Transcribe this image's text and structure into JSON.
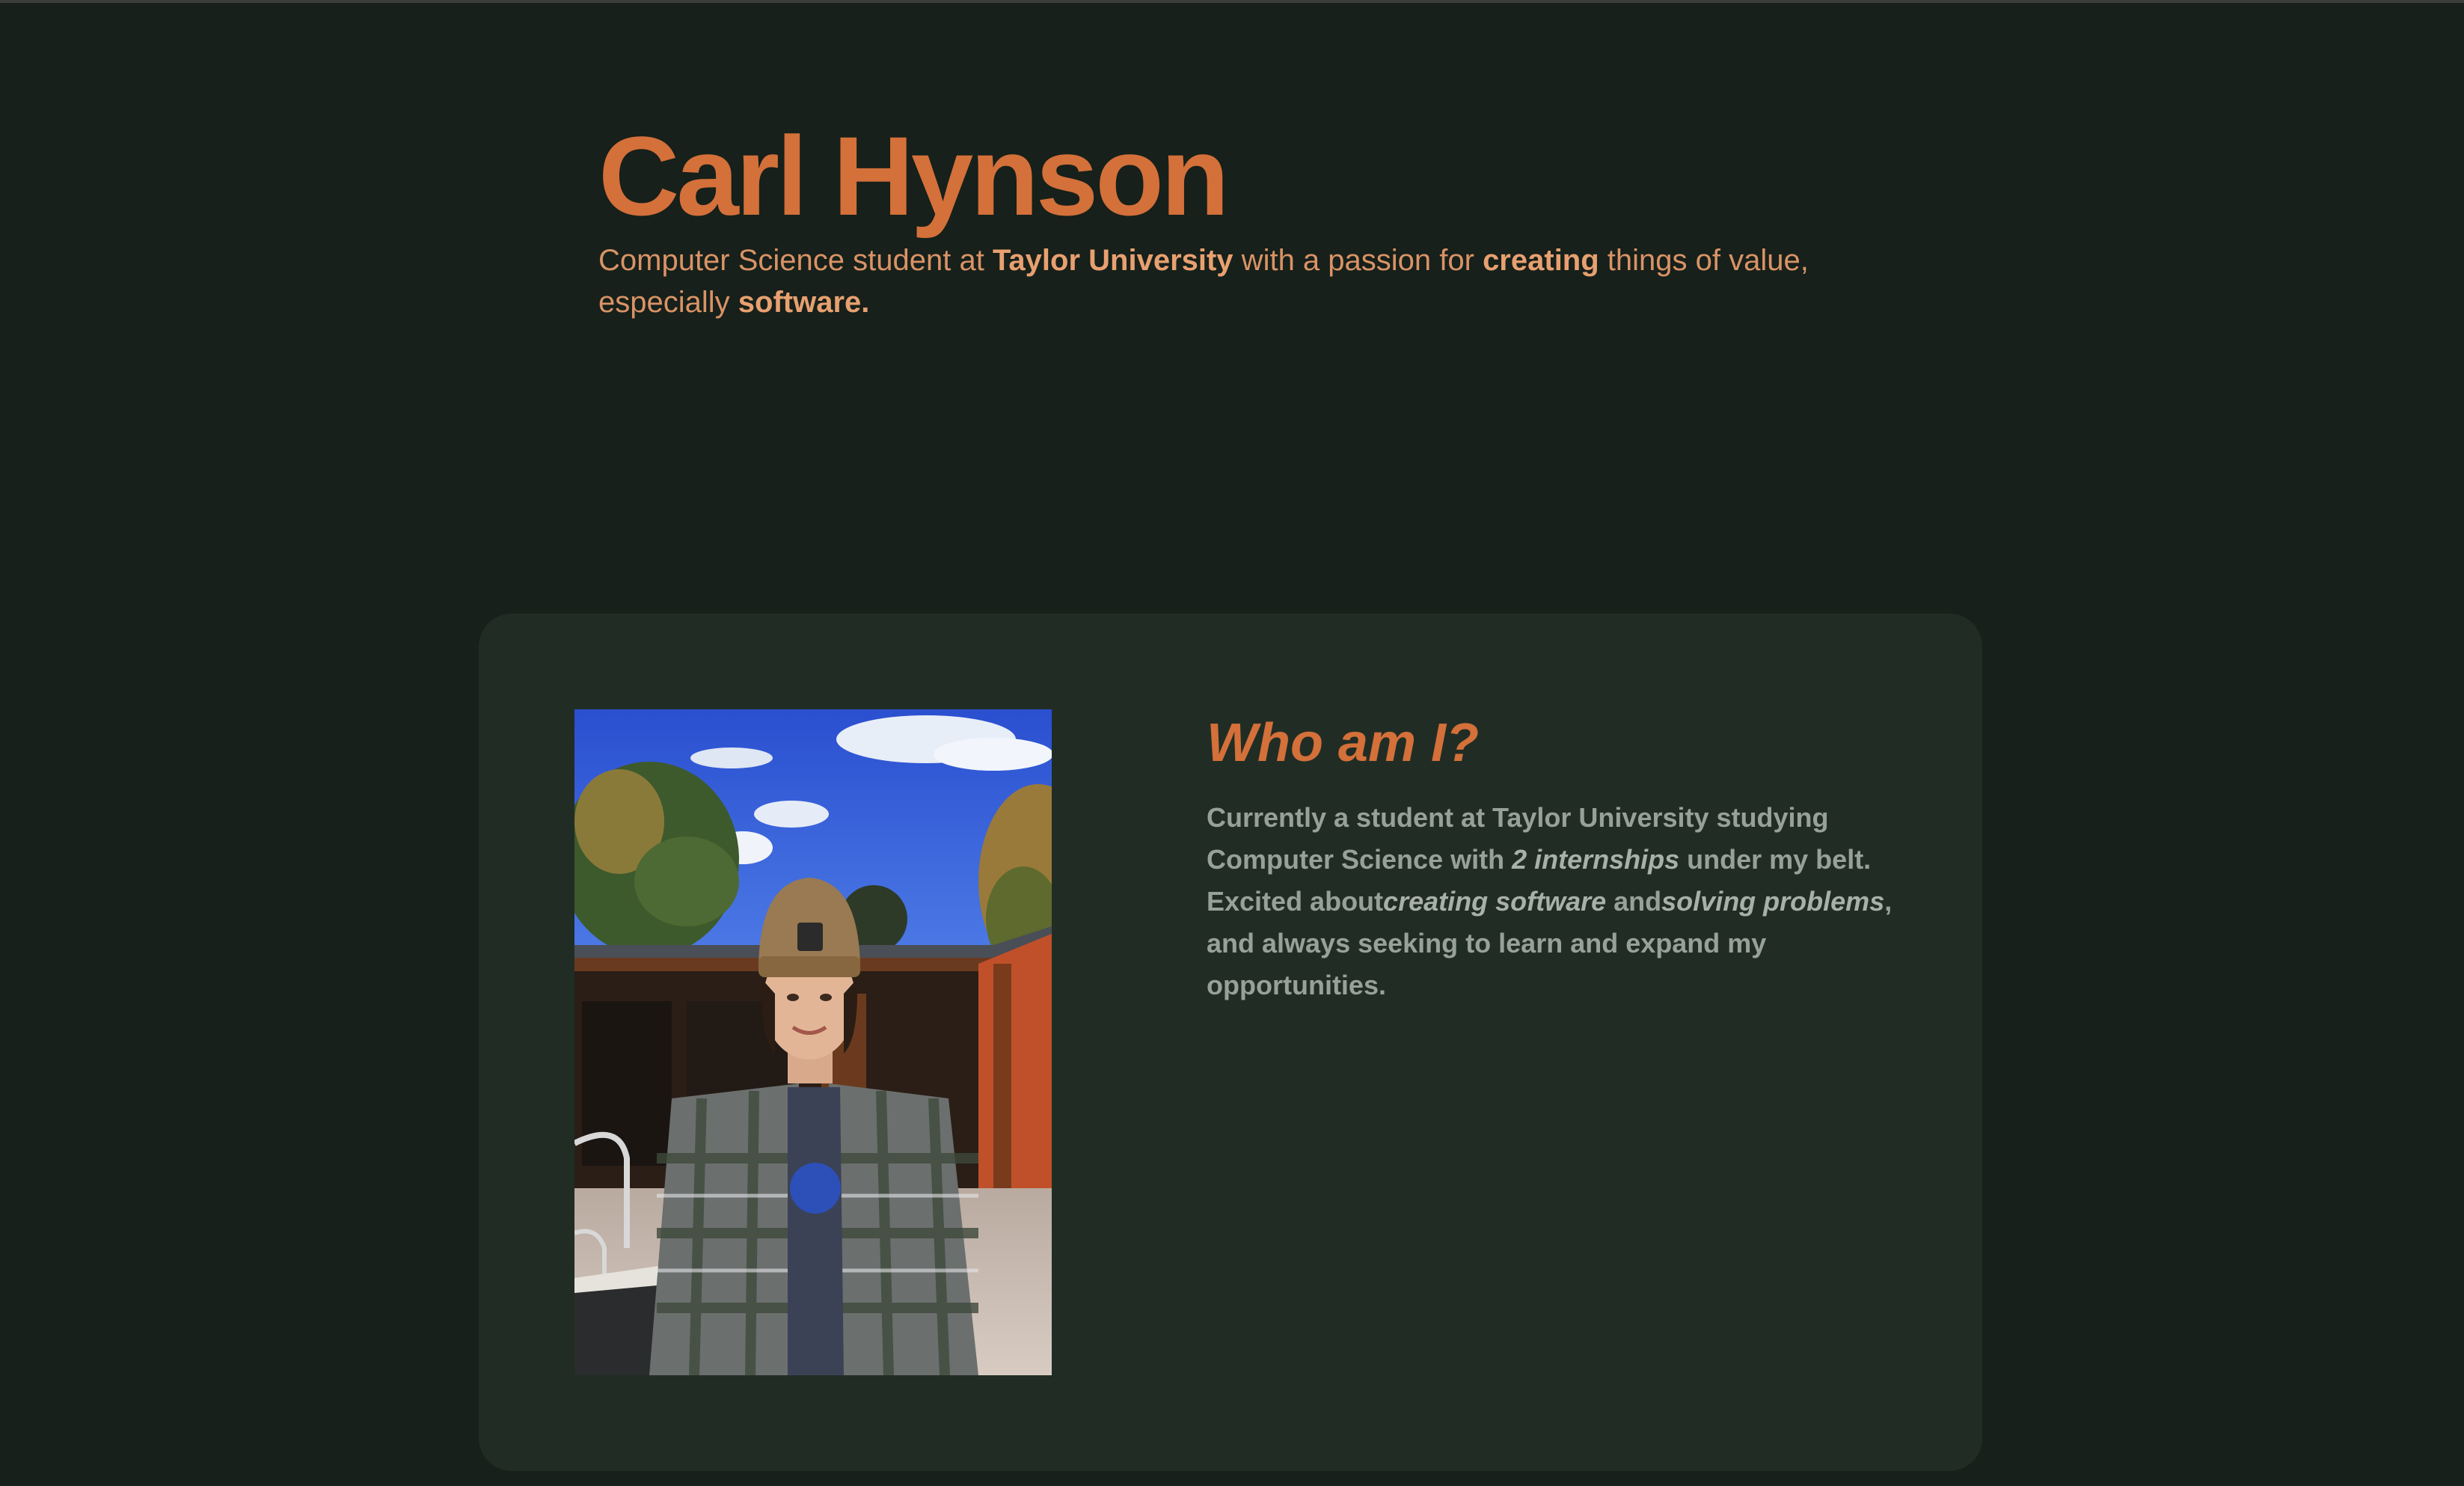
{
  "hero": {
    "title": "Carl Hynson",
    "subtitle": {
      "t1": "Computer Science student at ",
      "b1": "Taylor University",
      "t2": " with a passion for ",
      "b2": "creating",
      "t3": " things of value, especially ",
      "b3": "software."
    }
  },
  "about": {
    "heading": "Who am I?",
    "photo_icon": "profile-photo",
    "body": {
      "t1": "Currently a student at Taylor University studying Computer Science with ",
      "e1": "2 internships",
      "t2": " under my belt. Excited about",
      "e2": "creating software",
      "t3": " and",
      "e3": "solving problems",
      "t4": ", and always seeking to learn and expand my opportunities."
    }
  },
  "colors": {
    "background": "#17201a",
    "card": "#212d24",
    "accent": "#d4703a",
    "body_text": "#98a09a"
  }
}
